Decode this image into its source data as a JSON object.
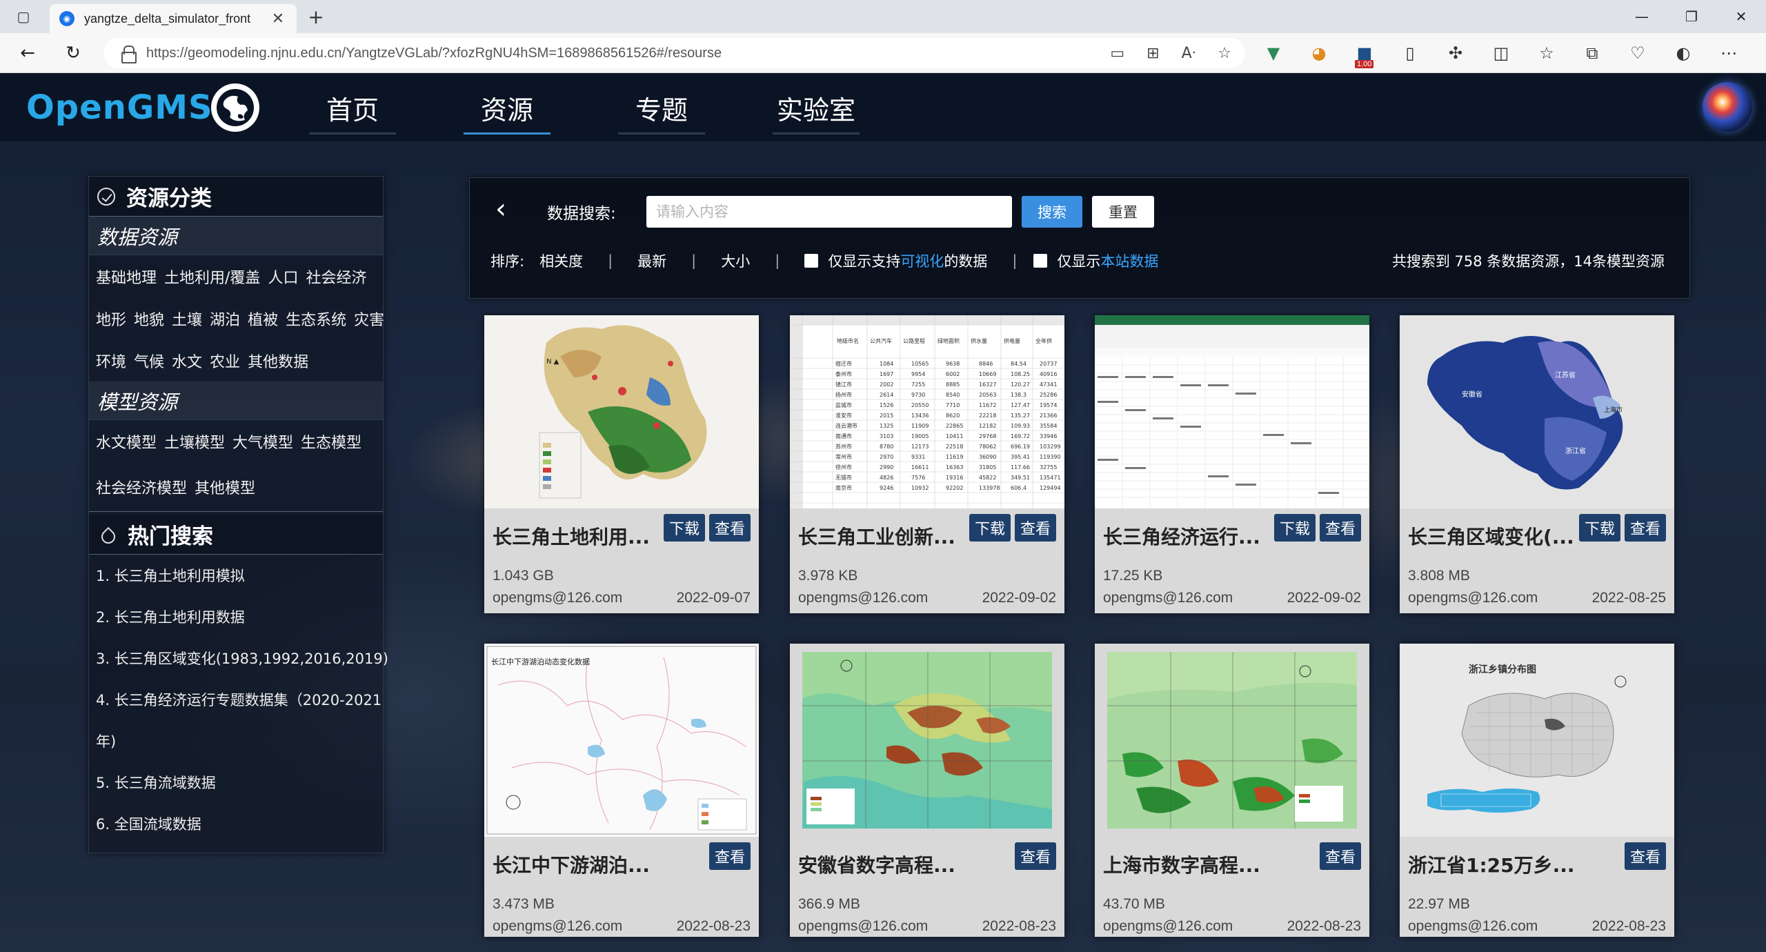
{
  "browser": {
    "tab_title": "yangtze_delta_simulator_front",
    "url": "https://geomodeling.njnu.edu.cn/YangtzeVGLab/?xfozRgNU4hSM=1689868561526#/resourse",
    "ext_badge": "1.00"
  },
  "header": {
    "logo_text": "OpenGMS",
    "nav": [
      "首页",
      "资源",
      "专题",
      "实验室"
    ],
    "active_nav": "资源"
  },
  "sidebar": {
    "category_title": "资源分类",
    "data_resources_title": "数据资源",
    "data_tags": [
      [
        "基础地理",
        "土地利用/覆盖",
        "人口",
        "社会经济"
      ],
      [
        "地形",
        "地貌",
        "土壤",
        "湖泊",
        "植被",
        "生态系统",
        "灾害"
      ],
      [
        "环境",
        "气候",
        "水文",
        "农业",
        "其他数据"
      ]
    ],
    "model_resources_title": "模型资源",
    "model_tags": [
      [
        "水文模型",
        "土壤模型",
        "大气模型",
        "生态模型"
      ],
      [
        "社会经济模型",
        "其他模型"
      ]
    ],
    "hot_title": "热门搜索",
    "hot_items": [
      "1. 长三角土地利用模拟",
      "2. 长三角土地利用数据",
      "3. 长三角区域变化(1983,1992,2016,2019)",
      "4. 长三角经济运行专题数据集（2020-2021",
      "年)",
      "5. 长三角流域数据",
      "6. 全国流域数据"
    ]
  },
  "search": {
    "label": "数据搜索:",
    "placeholder": "请输入内容",
    "search_btn": "搜索",
    "reset_btn": "重置",
    "sort_label": "排序:",
    "sort_options": [
      "相关度",
      "最新",
      "大小"
    ],
    "filter_vis_prefix": "仅显示支持",
    "filter_vis_highlight": "可视化",
    "filter_vis_suffix": "的数据",
    "filter_site_prefix": "仅显示",
    "filter_site_highlight": "本站数据",
    "result_count": "共搜索到 758 条数据资源，14条模型资源"
  },
  "cards": [
    {
      "title": "长三角土地利用...",
      "size": "1.043 GB",
      "user": "opengms@126.com",
      "date": "2022-09-07",
      "download": "下载",
      "view": "查看"
    },
    {
      "title": "长三角工业创新...",
      "size": "3.978 KB",
      "user": "opengms@126.com",
      "date": "2022-09-02",
      "download": "下载",
      "view": "查看"
    },
    {
      "title": "长三角经济运行...",
      "size": "17.25 KB",
      "user": "opengms@126.com",
      "date": "2022-09-02",
      "download": "下载",
      "view": "查看"
    },
    {
      "title": "长三角区域变化(...",
      "size": "3.808 MB",
      "user": "opengms@126.com",
      "date": "2022-08-25",
      "download": "下载",
      "view": "查看"
    },
    {
      "title": "长江中下游湖泊...",
      "size": "3.473 MB",
      "user": "opengms@126.com",
      "date": "2022-08-23",
      "view": "查看"
    },
    {
      "title": "安徽省数字高程...",
      "size": "366.9 MB",
      "user": "opengms@126.com",
      "date": "2022-08-23",
      "view": "查看"
    },
    {
      "title": "上海市数字高程...",
      "size": "43.70 MB",
      "user": "opengms@126.com",
      "date": "2022-08-23",
      "view": "查看"
    },
    {
      "title": "浙江省1:25万乡...",
      "size": "22.97 MB",
      "user": "opengms@126.com",
      "date": "2022-08-23",
      "view": "查看"
    }
  ],
  "thumbs": {
    "lake_map_title": "长江中下游湖泊动态变化数据",
    "zhejiang_map_title": "浙江乡镇分布图"
  }
}
